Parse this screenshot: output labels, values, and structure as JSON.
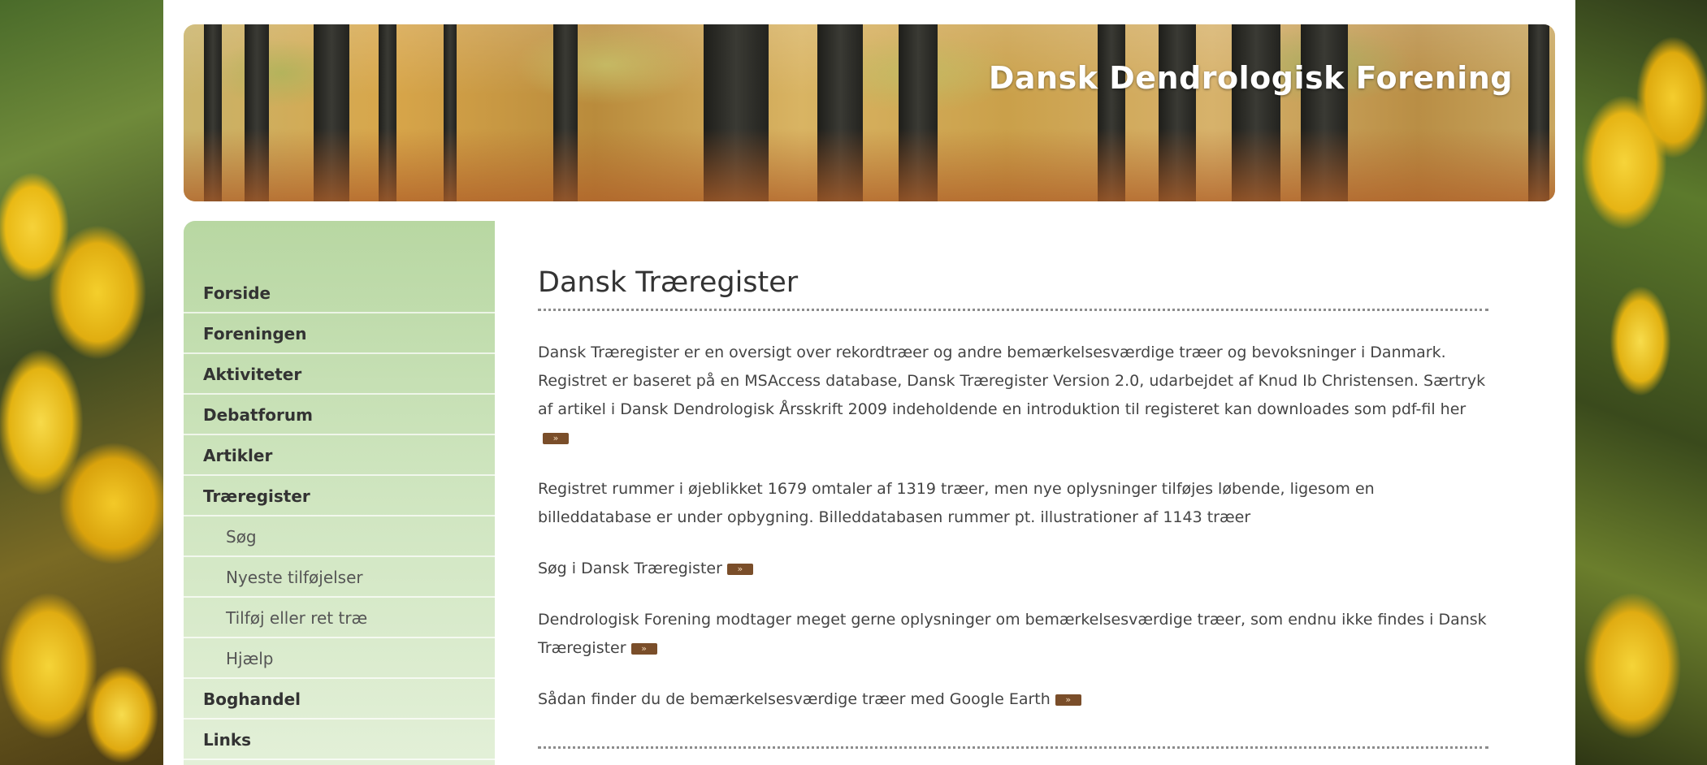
{
  "site": {
    "name": "Dansk Dendrologisk Forening"
  },
  "nav": {
    "items": [
      {
        "label": "Forside",
        "level": "top"
      },
      {
        "label": "Foreningen",
        "level": "top"
      },
      {
        "label": "Aktiviteter",
        "level": "top"
      },
      {
        "label": "Debatforum",
        "level": "top"
      },
      {
        "label": "Artikler",
        "level": "top"
      },
      {
        "label": "Træregister",
        "level": "top"
      },
      {
        "label": "Søg",
        "level": "sub"
      },
      {
        "label": "Nyeste tilføjelser",
        "level": "sub"
      },
      {
        "label": "Tilføj eller ret træ",
        "level": "sub"
      },
      {
        "label": "Hjælp",
        "level": "sub"
      },
      {
        "label": "Boghandel",
        "level": "top"
      },
      {
        "label": "Links",
        "level": "top"
      }
    ]
  },
  "content": {
    "title": "Dansk Træregister",
    "p1_text": "Dansk Træregister er en oversigt over rekordtræer og andre bemærkelsesværdige træer og bevoksninger i Danmark. Registret er baseret på en MSAccess database, Dansk Træregister Version 2.0, udarbejdet af Knud Ib Christensen. Særtryk af artikel i Dansk Dendrologisk Årsskrift 2009 indeholdende en introduktion til registeret kan downloades som pdf-fil her",
    "p2_text": "Registret rummer i øjeblikket 1679 omtaler af 1319 træer, men nye oplysninger tilføjes løbende, ligesom en billeddatabase er under opbygning. Billeddatabasen rummer pt. illustrationer af 1143 træer",
    "p3_link": "Søg i Dansk Træregister",
    "p4_text": "Dendrologisk Forening modtager meget gerne oplysninger om bemærkelsesværdige træer, som endnu ikke findes i Dansk Træregister",
    "p5_link": "Sådan finder du de bemærkelsesværdige træer med Google Earth",
    "arrow_glyph": "»"
  },
  "colors": {
    "sidebar_green": "#b8d7a2",
    "arrow_brown": "#7a4e2a"
  }
}
